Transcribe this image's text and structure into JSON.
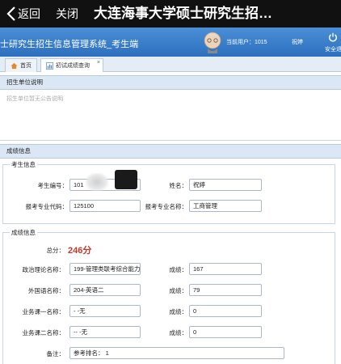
{
  "topbar": {
    "back_label": "返回",
    "close_label": "关闭",
    "title": "大连海事大学硕士研究生招…"
  },
  "header": {
    "system_title": "士研究生招生信息管理系统_考生端",
    "user_label": "当前用户：1015",
    "user_name": "祝婷",
    "exit_label": "安全退"
  },
  "tabs": [
    {
      "label": "首页",
      "icon": "home-icon"
    },
    {
      "label": "初试成绩查询",
      "icon": "chart-icon"
    }
  ],
  "notice": {
    "heading": "招生单位说明",
    "text": "招生单位暂无公告说明"
  },
  "scores": {
    "heading": "成绩信息",
    "examinee": {
      "legend": "考生信息",
      "exam_no_label": "考生编号：",
      "exam_no": "101",
      "name_label": "姓名：",
      "name": "祝婷",
      "major_code_label": "报考专业代码：",
      "major_code": "125100",
      "major_name_label": "报考专业名称：",
      "major_name": "工商管理"
    },
    "results": {
      "legend": "成绩信息",
      "total_label": "总分：",
      "total": "246分",
      "subjects": [
        {
          "name_label": "政治理论名称：",
          "name": "199-管理类联考综合能力",
          "score_label": "成绩：",
          "score": "167"
        },
        {
          "name_label": "外国语名称：",
          "name": "204-英语二",
          "score_label": "成绩：",
          "score": "79"
        },
        {
          "name_label": "业务课一名称：",
          "name": "- -无",
          "score_label": "成绩：",
          "score": "0"
        },
        {
          "name_label": "业务课二名称：",
          "name": "-- -无",
          "score_label": "成绩：",
          "score": "0"
        }
      ],
      "remark_label": "备注：",
      "remark": "参考排名：   1"
    }
  },
  "colors": {
    "header_blue": "#2d6fbe",
    "total_red": "#c0392b",
    "panel_head": "#dbe7f4"
  }
}
